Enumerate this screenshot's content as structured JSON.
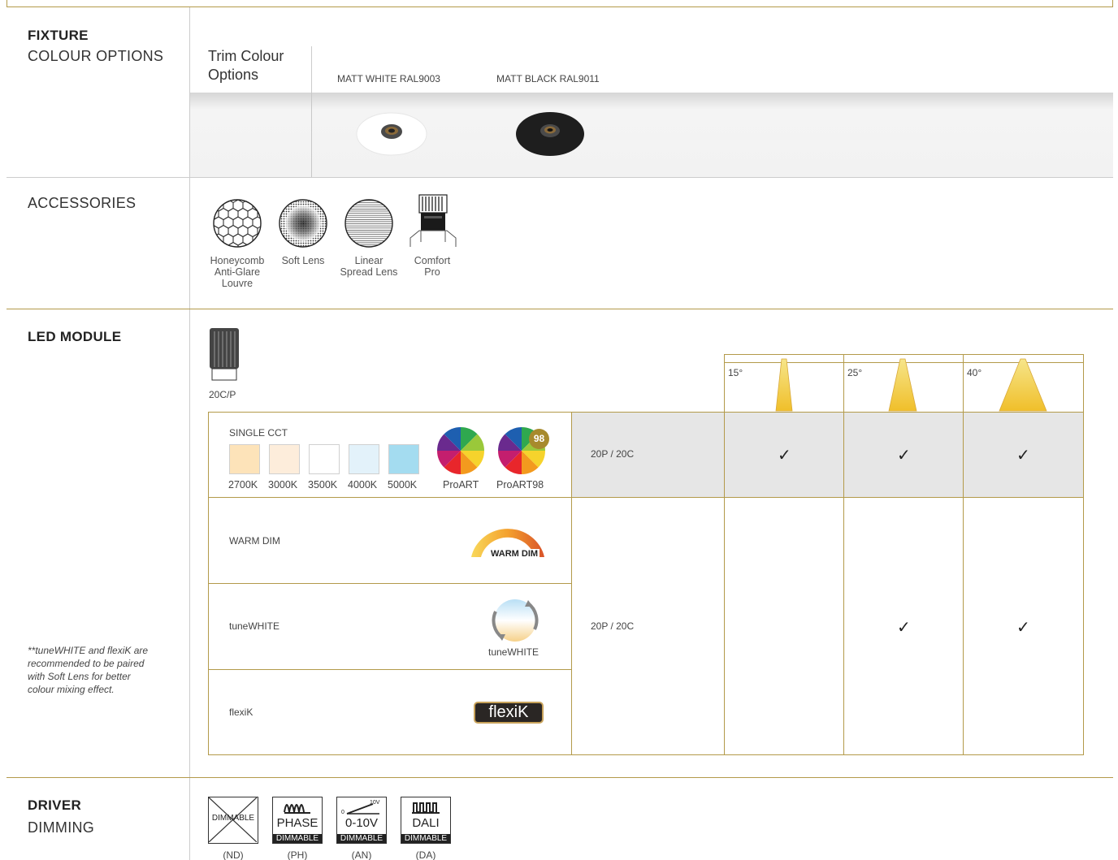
{
  "fixture": {
    "title": "FIXTURE",
    "subtitle": "COLOUR OPTIONS",
    "trim_label": "Trim Colour Options",
    "colours": [
      {
        "name": "MATT WHITE RAL9003",
        "hex": "#ffffff"
      },
      {
        "name": "MATT BLACK RAL9011",
        "hex": "#1e1e1e"
      }
    ]
  },
  "accessories": {
    "title": "ACCESSORIES",
    "items": [
      {
        "label": "Honeycomb Anti-Glare Louvre",
        "icon": "honeycomb-icon"
      },
      {
        "label": "Soft Lens",
        "icon": "soft-lens-icon"
      },
      {
        "label": "Linear Spread Lens",
        "icon": "linear-lens-icon"
      },
      {
        "label": "Comfort Pro",
        "icon": "comfort-pro-icon"
      }
    ]
  },
  "led": {
    "title": "LED MODULE",
    "module_label": "20C/P",
    "beam_angles": [
      "15°",
      "25°",
      "40°"
    ],
    "note": "**tuneWHITE and flexiK are recommended to be paired with Soft Lens for better colour mixing effect.",
    "single_cct": {
      "label": "SINGLE CCT",
      "swatches": [
        {
          "label": "2700K",
          "hex": "#fde3b9"
        },
        {
          "label": "3000K",
          "hex": "#fdeddb"
        },
        {
          "label": "3500K",
          "hex": "#ffffff"
        },
        {
          "label": "4000K",
          "hex": "#e3f2fa"
        },
        {
          "label": "5000K",
          "hex": "#a4dcf0"
        }
      ],
      "proart": "ProART",
      "proart98": "ProART98",
      "proart98_badge": "98",
      "module": "20P / 20C",
      "checks": [
        "✓",
        "✓",
        "✓"
      ]
    },
    "warm_dim": {
      "label": "WARM DIM",
      "logo": "WARM DIM"
    },
    "tune_white": {
      "label": "tuneWHITE",
      "logo": "tuneWHITE"
    },
    "flexik": {
      "label": "flexiK",
      "logo": "flexiK"
    },
    "group_module": "20P / 20C",
    "group_checks": [
      "",
      "✓",
      "✓"
    ]
  },
  "driver": {
    "title": "DRIVER",
    "subtitle": "DIMMING",
    "items": [
      {
        "code": "(ND)",
        "main": "DIMMABLE",
        "bar": ""
      },
      {
        "code": "(PH)",
        "main": "PHASE",
        "bar": "DIMMABLE"
      },
      {
        "code": "(AN)",
        "main": "0-10V",
        "bar": "DIMMABLE",
        "tag": "10V",
        "zero": "0"
      },
      {
        "code": "(DA)",
        "main": "DALI",
        "bar": "DIMMABLE"
      }
    ]
  },
  "colors": {
    "accent": "#b39a4a"
  }
}
